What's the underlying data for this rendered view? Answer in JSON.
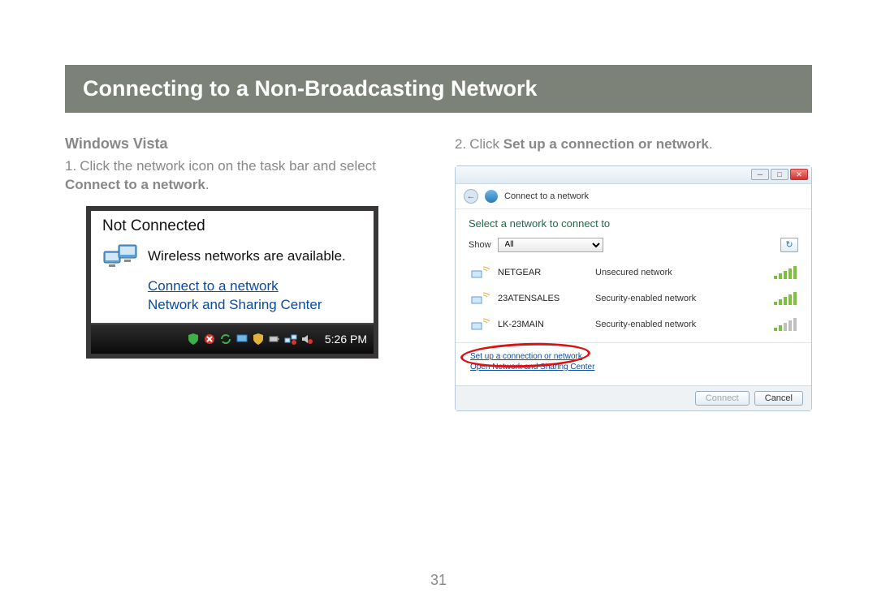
{
  "title": "Connecting to a Non-Broadcasting Network",
  "left": {
    "subhead": "Windows Vista",
    "step_num": "1.",
    "step_a": "Click the network icon on the task bar and select ",
    "step_b_bold": "Connect to a network",
    "step_c": ".",
    "tooltip": {
      "title": "Not Connected",
      "available": "Wireless networks are available.",
      "link_connect": "Connect to a network",
      "link_center": "Network and Sharing Center"
    },
    "clock": "5:26 PM"
  },
  "right": {
    "step_num": "2.",
    "step_a": "Click ",
    "step_b_bold": "Set up a connection or network",
    "step_c": ".",
    "dialog": {
      "title": "Connect to a network",
      "select_label": "Select a network to connect to",
      "show_label": "Show",
      "show_value": "All",
      "networks": [
        {
          "name": "NETGEAR",
          "security": "Unsecured network",
          "strength": "full"
        },
        {
          "name": "23ATENSALES",
          "security": "Security-enabled network",
          "strength": "full"
        },
        {
          "name": "LK-23MAIN",
          "security": "Security-enabled network",
          "strength": "low"
        }
      ],
      "link_setup": "Set up a connection or network",
      "link_open": "Open Network and Sharing Center",
      "btn_connect": "Connect",
      "btn_cancel": "Cancel"
    }
  },
  "page_number": "31"
}
